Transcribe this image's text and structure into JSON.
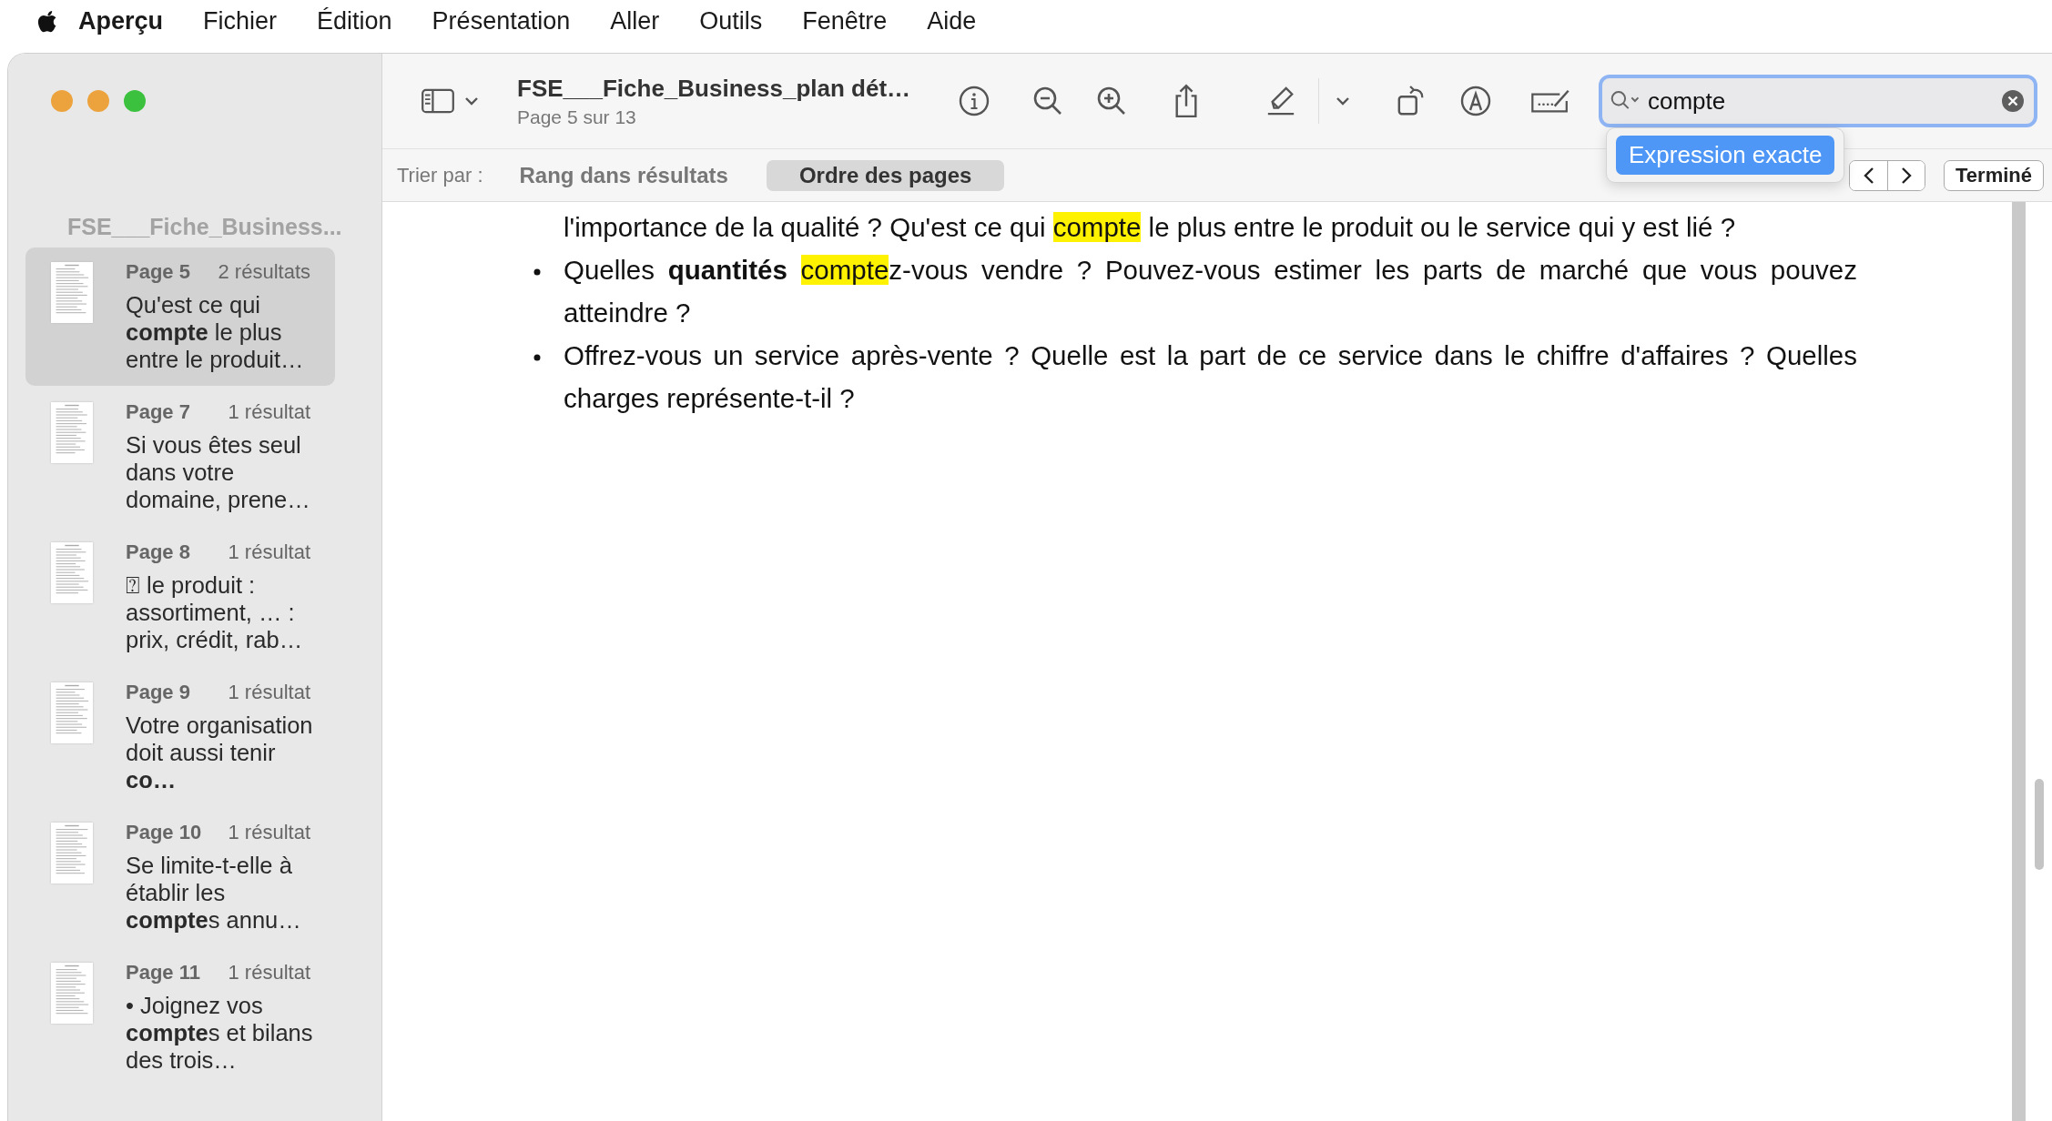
{
  "menu_bar": {
    "app": "Aperçu",
    "items": [
      "Fichier",
      "Édition",
      "Présentation",
      "Aller",
      "Outils",
      "Fenêtre",
      "Aide"
    ]
  },
  "sidebar": {
    "title": "FSE___Fiche_Business...",
    "results": [
      {
        "page": "Page 5",
        "count": "2 résultats",
        "snippet": "Qu'est ce qui **compte** le plus entre le produit…",
        "selected": true
      },
      {
        "page": "Page 7",
        "count": "1 résultat",
        "snippet": "Si vous êtes seul dans votre domaine, prene…",
        "selected": false
      },
      {
        "page": "Page 8",
        "count": "1 résultat",
        "snippet": "⍰ le produit : assortiment, … : prix, crédit, rab…",
        "selected": false
      },
      {
        "page": "Page 9",
        "count": "1 résultat",
        "snippet": "Votre organisation doit aussi tenir **co…**",
        "selected": false
      },
      {
        "page": "Page 10",
        "count": "1 résultat",
        "snippet": "Se limite-t-elle à établir les **compte**s annu…",
        "selected": false
      },
      {
        "page": "Page 11",
        "count": "1 résultat",
        "snippet": "• Joignez vos **compte**s et bilans des trois…",
        "selected": false
      }
    ]
  },
  "toolbar": {
    "title": "FSE___Fiche_Business_plan dét…",
    "subtitle": "Page 5 sur 13",
    "search": {
      "value": "compte"
    },
    "search_option": "Expression exacte"
  },
  "sort_bar": {
    "label": "Trier par :",
    "options": [
      {
        "label": "Rang dans résultats",
        "selected": false
      },
      {
        "label": "Ordre des pages",
        "selected": true
      }
    ],
    "done": "Terminé"
  },
  "document": {
    "paragraphs": [
      {
        "bullet": false,
        "runs": [
          {
            "kind": "plain",
            "text": "l'importance de la qualité ? Qu'est ce qui "
          },
          {
            "kind": "match",
            "text": "compte"
          },
          {
            "kind": "plain",
            "text": " le plus entre le produit ou le service qui y est lié ?"
          }
        ]
      },
      {
        "bullet": true,
        "runs": [
          {
            "kind": "plain",
            "text": "Quelles "
          },
          {
            "kind": "bold",
            "text": "quantités "
          },
          {
            "kind": "match",
            "text": "compte"
          },
          {
            "kind": "plain",
            "text": "z-vous vendre ? Pouvez-vous estimer les parts de marché que vous pouvez atteindre ?"
          }
        ]
      },
      {
        "bullet": true,
        "runs": [
          {
            "kind": "plain",
            "text": "Offrez-vous un service après-vente ? Quelle est la part de ce service dans le chiffre d'affaires ? Quelles charges représente-t-il ?"
          }
        ]
      }
    ]
  }
}
